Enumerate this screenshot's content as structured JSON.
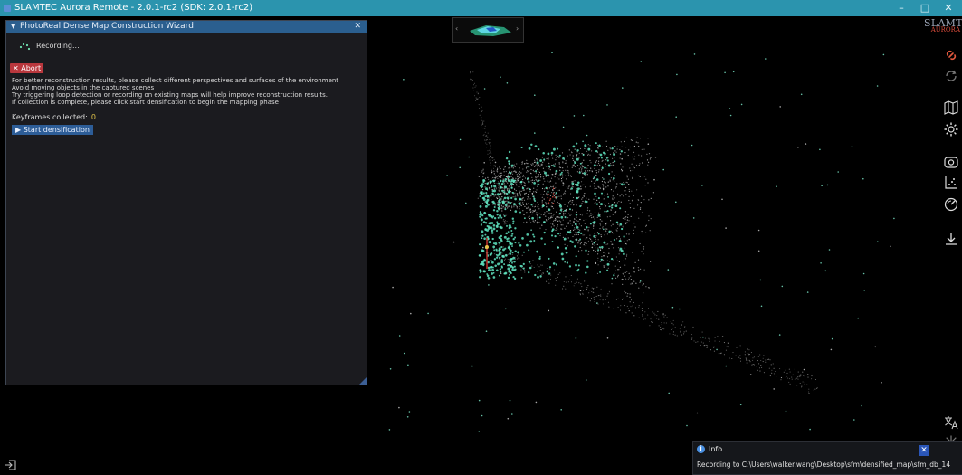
{
  "window": {
    "title": "SLAMTEC Aurora Remote - 2.0.1-rc2 (SDK: 2.0.1-rc2)"
  },
  "window_controls": {
    "minimize": "–",
    "maximize": "□",
    "close": "✕"
  },
  "wizard": {
    "title": "PhotoReal Dense Map Construction Wizard",
    "status_label": "Recording...",
    "abort_label": "✕ Abort",
    "instructions": [
      "For better reconstruction results, please collect different perspectives and surfaces of the environment",
      "Avoid moving objects in the captured scenes",
      "Try triggering loop detection or recording on existing maps will help improve reconstruction results.",
      "If collection is complete, please click start densification to begin the mapping phase"
    ],
    "keyframes_label": "Keyframes collected:",
    "keyframes_value": "0",
    "start_label": "▶ Start densification"
  },
  "brand": {
    "line1": "SLAMTEC",
    "line2": "AURORA"
  },
  "right_toolbar": [
    "link-icon",
    "refresh-icon",
    "map-icon",
    "settings-icon",
    "camera-icon",
    "point-cloud-icon",
    "gauge-icon",
    "download-icon"
  ],
  "bottom_right_icons": [
    "translate-icon",
    "theme-icon"
  ],
  "colors": {
    "titlebar": "#2b94ae",
    "wizard_header": "#2b5f8f",
    "abort": "#b9373d",
    "start": "#2d5d97",
    "accent_icon": "#e2583e",
    "keyframes_value": "#e3c54a",
    "points_cyan": "#5fe3c0"
  },
  "info_toast": {
    "title": "Info",
    "message": "Recording to C:\\Users\\walker.wang\\Desktop\\sfm\\densified_map\\sfm_db_14",
    "close_label": "✕"
  }
}
